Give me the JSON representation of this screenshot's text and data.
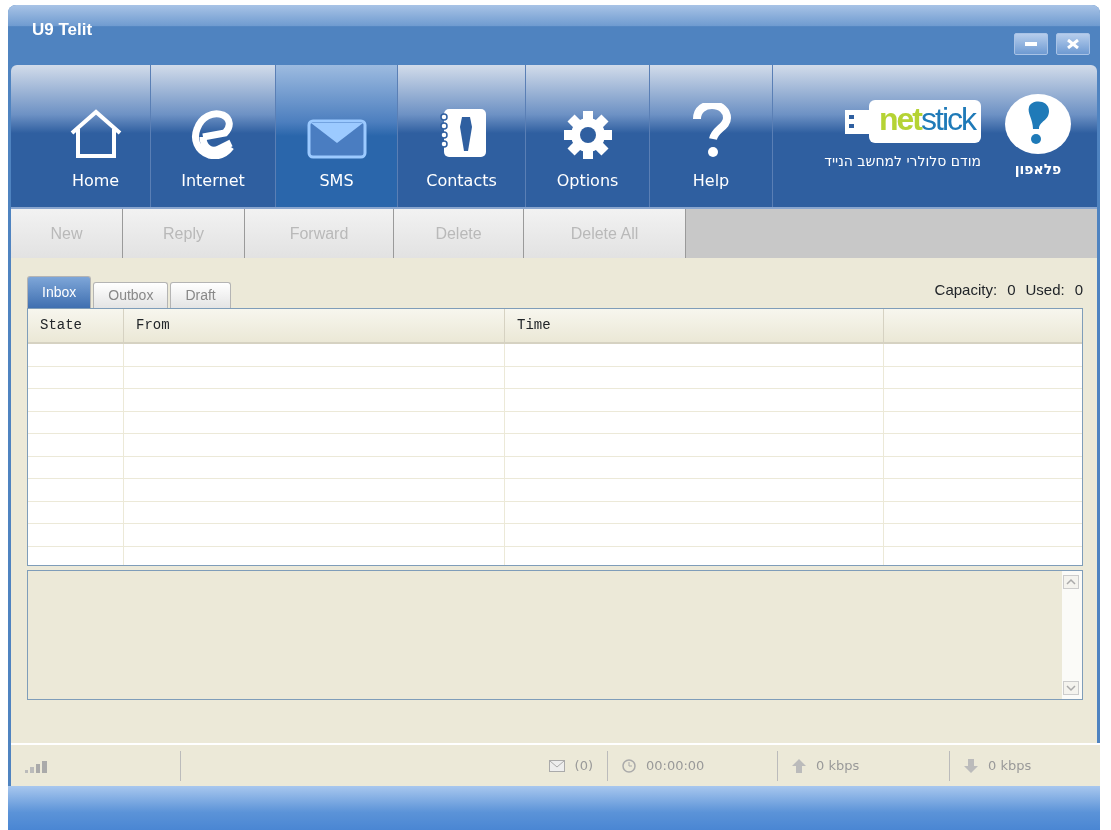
{
  "window": {
    "title": "U9 Telit"
  },
  "nav": [
    {
      "label": "Home",
      "selected": false
    },
    {
      "label": "Internet",
      "selected": false
    },
    {
      "label": "SMS",
      "selected": true
    },
    {
      "label": "Contacts",
      "selected": false
    },
    {
      "label": "Options",
      "selected": false
    },
    {
      "label": "Help",
      "selected": false
    }
  ],
  "logo": {
    "word": [
      {
        "text": "net",
        "color": "#b5d334"
      },
      {
        "text": "stick",
        "color": "#1f7ab8"
      }
    ],
    "tagline": "מודם סלולרי למחשב הנייד",
    "brand": "פלאפון"
  },
  "toolbar": [
    {
      "label": "New",
      "disabled": true
    },
    {
      "label": "Reply",
      "disabled": true
    },
    {
      "label": "Forward",
      "disabled": true
    },
    {
      "label": "Delete",
      "disabled": true
    },
    {
      "label": "Delete All",
      "disabled": true
    }
  ],
  "tabs": [
    {
      "label": "Inbox",
      "selected": true
    },
    {
      "label": "Outbox",
      "selected": false
    },
    {
      "label": "Draft",
      "selected": false
    }
  ],
  "capacity": {
    "label": "Capacity:",
    "value": "0",
    "used_label": "Used:",
    "used_value": "0"
  },
  "table": {
    "columns": [
      "State",
      "From",
      "Time"
    ]
  },
  "status_bar": {
    "sms_count": "(0)",
    "timer": "00:00:00",
    "upload": "0 kbps",
    "download": "0 kbps"
  }
}
